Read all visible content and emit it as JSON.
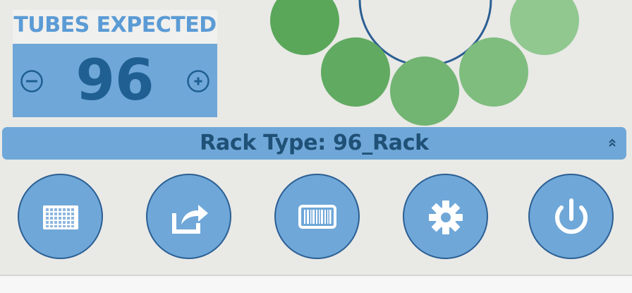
{
  "tubes_expected": {
    "title": "TUBES EXPECTED",
    "value": "96"
  },
  "rack": {
    "label": "Rack Type: 96_Rack"
  },
  "icons": {
    "decrease": "minus-circle-icon",
    "increase": "plus-circle-icon",
    "rack_toggle": "double-chevron-up-icon",
    "rack_layout": "grid-rack-icon",
    "export": "share-export-icon",
    "barcode": "barcode-icon",
    "settings": "gear-icon",
    "power": "power-icon"
  },
  "colors": {
    "panel_blue": "#6fa7d8",
    "title_blue": "#5b9bd5",
    "dark_blue": "#1f5f92",
    "outline_blue": "#2b5f93",
    "green_dark": "#5aa75a",
    "green_mid": "#6aaf6a",
    "green_light": "#8cc68c",
    "background": "#e9e9e6"
  }
}
